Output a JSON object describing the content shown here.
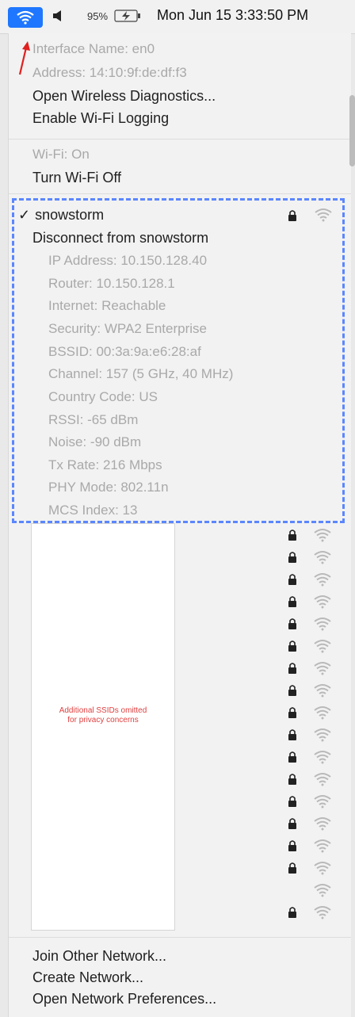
{
  "menubar": {
    "battery_percent": "95%",
    "clock": "Mon Jun 15  3:33:50 PM"
  },
  "menu": {
    "interface_name": "Interface Name: en0",
    "address": "Address: 14:10:9f:de:df:f3",
    "open_wireless_diagnostics": "Open Wireless Diagnostics...",
    "enable_wifi_logging": "Enable Wi-Fi Logging",
    "wifi_status": "Wi-Fi: On",
    "turn_wifi_off": "Turn Wi-Fi Off",
    "current_network": {
      "check": "✓",
      "ssid": "snowstorm",
      "disconnect": "Disconnect from snowstorm",
      "details": [
        "IP Address: 10.150.128.40",
        "Router: 10.150.128.1",
        "Internet: Reachable",
        "Security: WPA2 Enterprise",
        "BSSID: 00:3a:9a:e6:28:af",
        "Channel: 157 (5 GHz, 40 MHz)",
        "Country Code: US",
        "RSSI: -65 dBm",
        "Noise: -90 dBm",
        "Tx Rate: 216 Mbps",
        "PHY Mode: 802.11n",
        "MCS Index: 13"
      ]
    },
    "omitted_note": "Additional SSIDs omitted\nfor privacy concerns",
    "join_other": "Join Other Network...",
    "create_network": "Create Network...",
    "open_preferences": "Open Network Preferences..."
  },
  "colors": {
    "wifi_button_bg": "#1f77ff",
    "dashed_box": "#5b86ff",
    "arrow": "#e02020",
    "note": "#e04040"
  },
  "icons": [
    "wifi-icon",
    "speaker-icon",
    "battery-icon",
    "lock-icon",
    "wifi-signal-icon",
    "checkmark-icon",
    "red-arrow-icon"
  ]
}
